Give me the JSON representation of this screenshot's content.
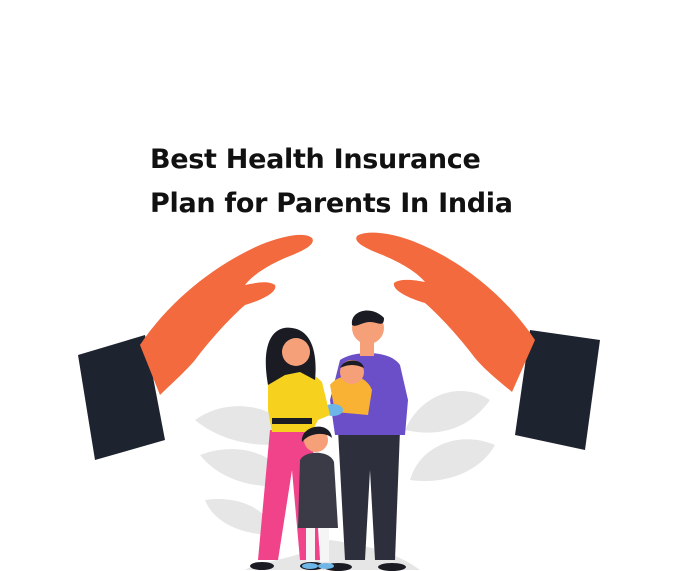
{
  "title": {
    "line1": "Best Health Insurance",
    "line2": "Plan for Parents In India"
  },
  "colors": {
    "skin_hand": "#F26A3D",
    "sleeve": "#1E2330",
    "leaf": "#E6E6E6",
    "mother_top": "#F6D21E",
    "mother_pants": "#F0438A",
    "father_shirt": "#6B4FC8",
    "father_pants": "#2E2F3D",
    "hair": "#1B1B24",
    "girl_dress": "#3A3B47",
    "baby_top": "#F9B233"
  }
}
